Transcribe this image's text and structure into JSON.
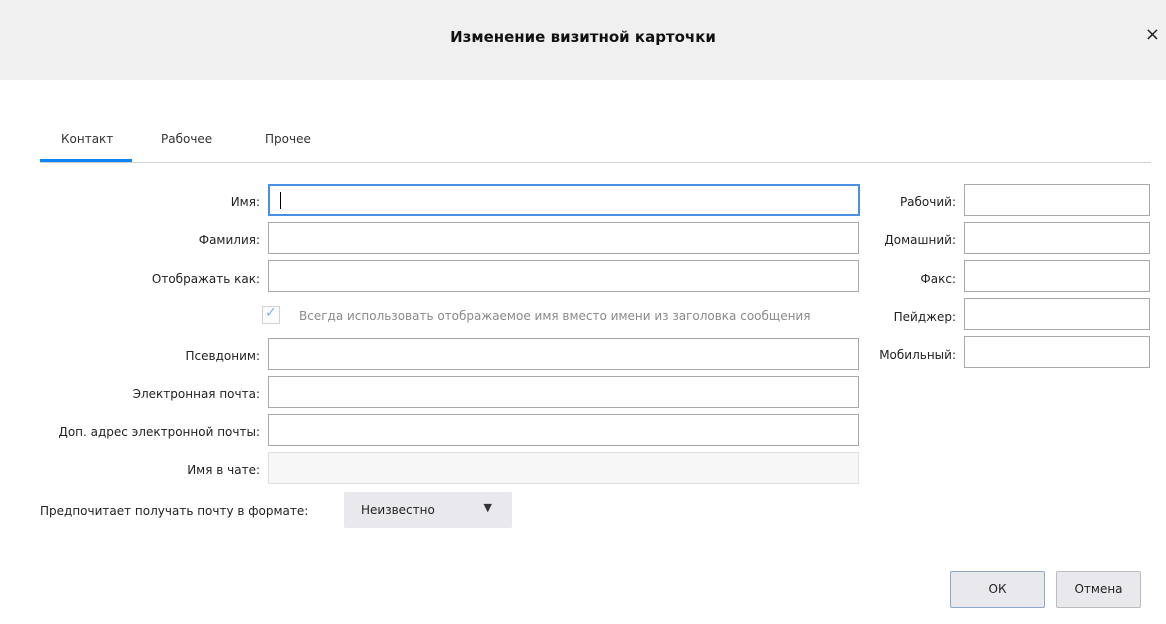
{
  "dialog": {
    "title": "Изменение визитной карточки",
    "close": "×"
  },
  "tabs": [
    {
      "label": "Контакт"
    },
    {
      "label": "Рабочее"
    },
    {
      "label": "Прочее"
    }
  ],
  "contact": {
    "first_name_label": "Имя:",
    "last_name_label": "Фамилия:",
    "display_name_label": "Отображать как:",
    "always_use_display_name_label": "Всегда использовать отображаемое имя вместо имени из заголовка сообщения",
    "always_use_display_name_checked": true,
    "nickname_label": "Псевдоним:",
    "email_label": "Электронная почта:",
    "additional_email_label": "Доп. адрес электронной почты:",
    "chat_name_label": "Имя в чате:",
    "mail_format_label": "Предпочитает получать почту в формате:",
    "mail_format_value": "Неизвестно"
  },
  "phones": {
    "work_label": "Рабочий:",
    "home_label": "Домашний:",
    "fax_label": "Факс:",
    "pager_label": "Пейджер:",
    "mobile_label": "Мобильный:"
  },
  "buttons": {
    "ok": "ОК",
    "cancel": "Отмена"
  },
  "icons": {
    "close": "close-icon",
    "checkmark": "checkmark-icon",
    "dropdown": "chevron-down-icon"
  },
  "colors": {
    "accent": "#0a84ff",
    "focus_border": "#4a90e2",
    "titlebar": "#f0f0f0"
  }
}
